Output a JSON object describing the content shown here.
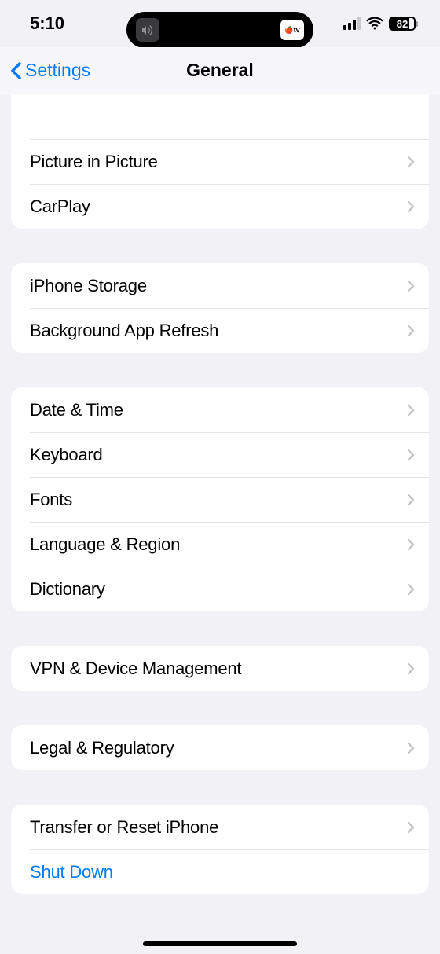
{
  "status": {
    "time": "5:10",
    "battery": "82",
    "island_right": "tv"
  },
  "nav": {
    "back": "Settings",
    "title": "General"
  },
  "groups": [
    {
      "partial": true,
      "items": [
        {
          "label": "Picture in Picture",
          "chevron": true
        },
        {
          "label": "CarPlay",
          "chevron": true
        }
      ]
    },
    {
      "items": [
        {
          "label": "iPhone Storage",
          "chevron": true
        },
        {
          "label": "Background App Refresh",
          "chevron": true
        }
      ]
    },
    {
      "items": [
        {
          "label": "Date & Time",
          "chevron": true
        },
        {
          "label": "Keyboard",
          "chevron": true
        },
        {
          "label": "Fonts",
          "chevron": true
        },
        {
          "label": "Language & Region",
          "chevron": true
        },
        {
          "label": "Dictionary",
          "chevron": true
        }
      ]
    },
    {
      "items": [
        {
          "label": "VPN & Device Management",
          "chevron": true
        }
      ]
    },
    {
      "items": [
        {
          "label": "Legal & Regulatory",
          "chevron": true
        }
      ]
    },
    {
      "items": [
        {
          "label": "Transfer or Reset iPhone",
          "chevron": true
        },
        {
          "label": "Shut Down",
          "chevron": false,
          "link": true
        }
      ]
    }
  ]
}
